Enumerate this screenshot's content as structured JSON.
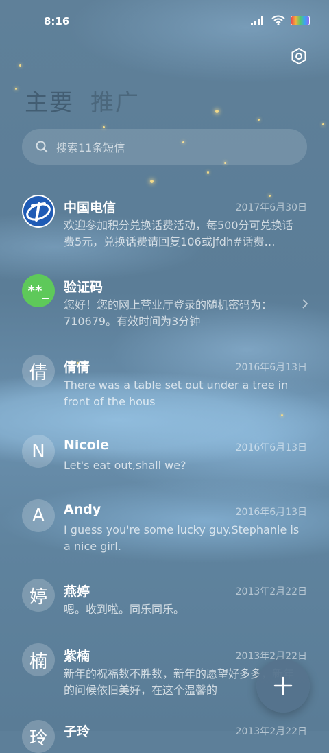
{
  "status_bar": {
    "time": "8:16",
    "icons": [
      "signal-icon",
      "wifi-icon",
      "battery-icon"
    ]
  },
  "header": {
    "settings_icon": "gear-icon"
  },
  "tabs": [
    {
      "label": "主要",
      "active": true
    },
    {
      "label": "推广",
      "active": false
    }
  ],
  "search": {
    "placeholder": "搜索11条短信"
  },
  "messages": [
    {
      "sender": "中国电信",
      "avatar_text": "",
      "avatar_kind": "china-telecom-logo",
      "date": "2017年6月30日",
      "preview": "欢迎参加积分兑换话费活动，每500分可兑换话费5元，兑换话费请回复106或jfdh#话费…"
    },
    {
      "sender": "验证码",
      "avatar_text": "**_",
      "avatar_kind": "verification",
      "date": "",
      "preview": "您好！您的网上营业厅登录的随机密码为：710679。有效时间为3分钟"
    },
    {
      "sender": "倩倩",
      "avatar_text": "倩",
      "date": "2016年6月13日",
      "preview": "There was a table set out under a tree in front of the hous"
    },
    {
      "sender": "Nicole",
      "avatar_text": "N",
      "date": "2016年6月13日",
      "preview": "Let's eat out,shall we?"
    },
    {
      "sender": "Andy",
      "avatar_text": "A",
      "date": "2016年6月13日",
      "preview": "I guess you're some lucky guy.Stephanie is a nice girl."
    },
    {
      "sender": "燕婷",
      "avatar_text": "婷",
      "date": "2013年2月22日",
      "preview": "嗯。收到啦。同乐同乐。"
    },
    {
      "sender": "紫楠",
      "avatar_text": "楠",
      "date": "2013年2月22日",
      "preview": "新年的祝福数不胜数，新年的愿望好多多，新年的问候依旧美好，在这个温馨的"
    },
    {
      "sender": "子玲",
      "avatar_text": "玲",
      "date": "2013年2月22日",
      "preview": ""
    }
  ],
  "fab": {
    "icon": "plus-icon"
  },
  "colors": {
    "verification_avatar": "#5ec95a",
    "telecom_blue": "#1f5bb5"
  }
}
